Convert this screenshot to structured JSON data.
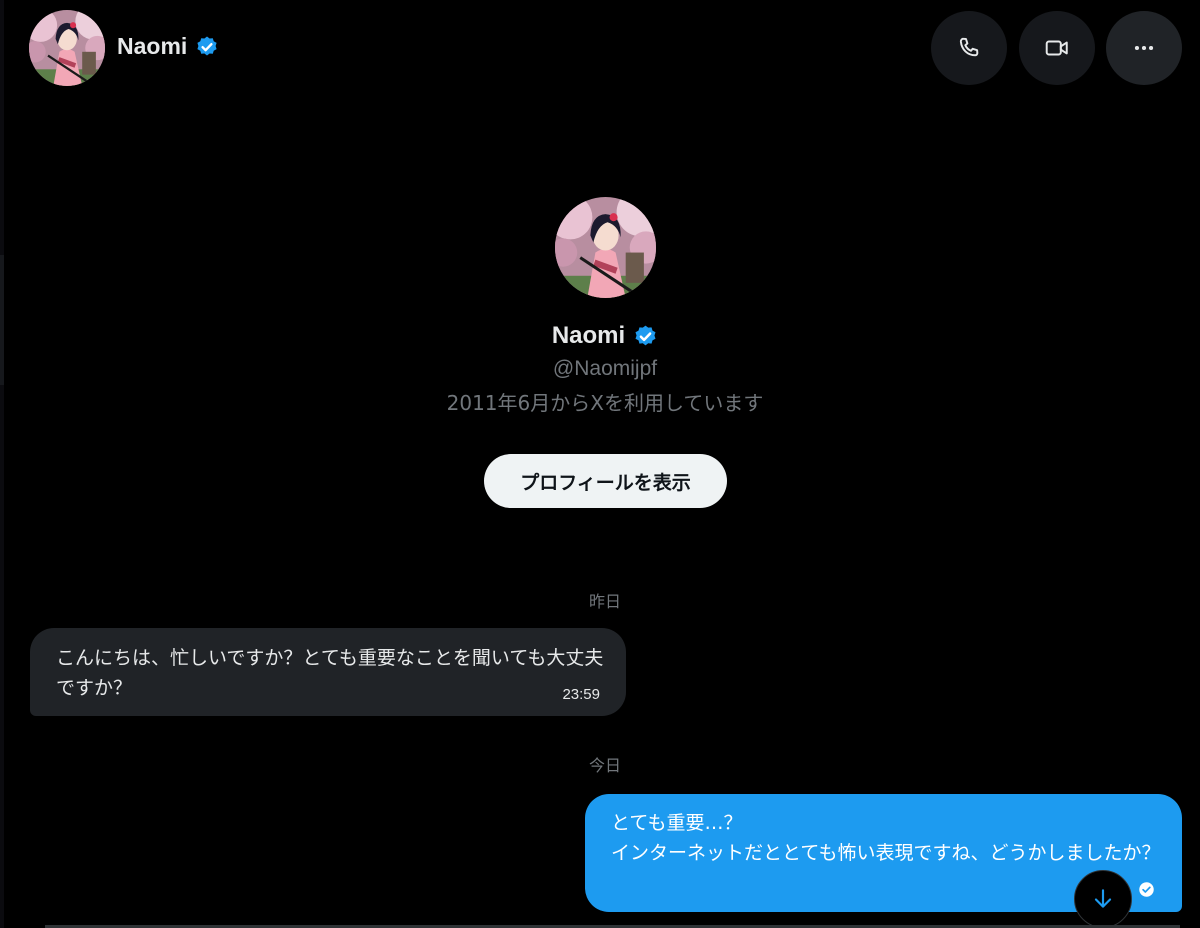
{
  "header": {
    "name": "Naomi",
    "avatar_icon": "profile-avatar-illustration",
    "verified_icon": "verified-badge-icon",
    "actions": [
      {
        "icon": "phone-icon",
        "label": "Call"
      },
      {
        "icon": "video-camera-icon",
        "label": "Video call"
      },
      {
        "icon": "more-horizontal-icon",
        "label": "More"
      }
    ]
  },
  "profile": {
    "name": "Naomi",
    "handle": "@Naomijpf",
    "joined": "2011年6月からXを利用しています",
    "view_profile_label": "プロフィールを表示"
  },
  "messages": {
    "groups": [
      {
        "date_label": "昨日",
        "items": [
          {
            "direction": "incoming",
            "text": "こんにちは、忙しいですか？とても重要なことを聞いても大丈夫ですか？",
            "time": "23:59"
          }
        ]
      },
      {
        "date_label": "今日",
        "items": [
          {
            "direction": "outgoing",
            "text": "とても重要…？\nインターネットだととても怖い表現ですね、どうかしましたか？",
            "status_icon": "seen-check-icon"
          }
        ]
      }
    ]
  },
  "scroll_button_icon": "arrow-down-icon",
  "colors": {
    "background": "#000000",
    "accent": "#1d9bf0",
    "incoming_bubble": "#202327",
    "muted_text": "#71767b",
    "primary_text": "#e7e9ea"
  }
}
